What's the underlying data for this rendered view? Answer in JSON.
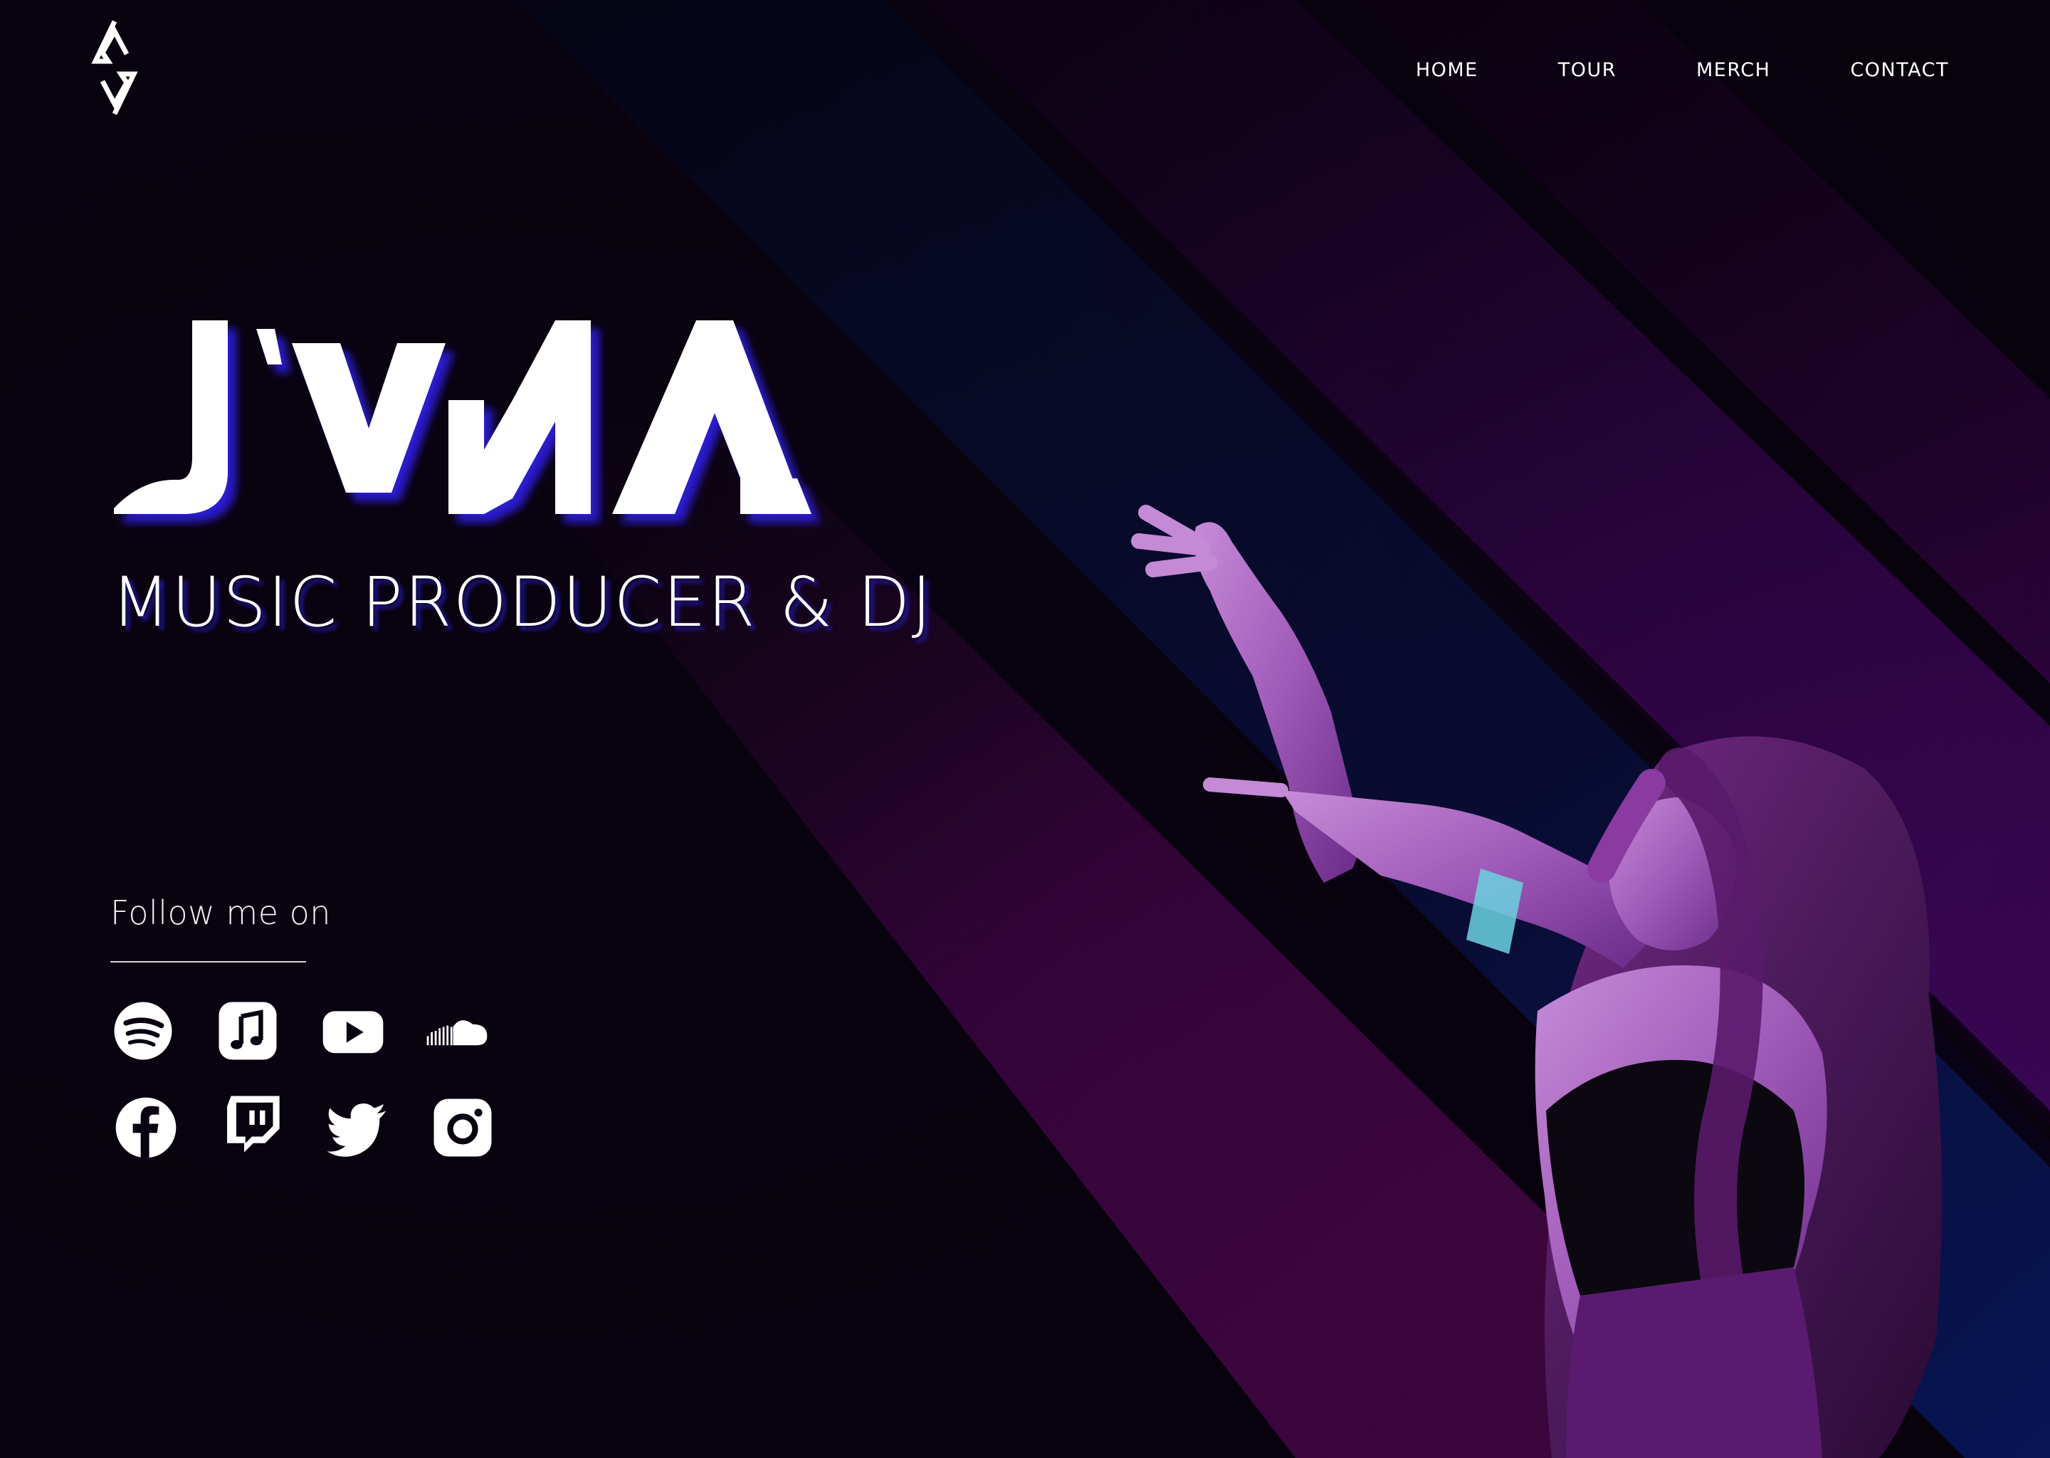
{
  "nav": {
    "items": [
      {
        "label": "HOME"
      },
      {
        "label": "TOUR"
      },
      {
        "label": "MERCH"
      },
      {
        "label": "CONTACT"
      }
    ]
  },
  "hero": {
    "brand": "JVNA",
    "subtitle": "MUSIC PRODUCER & DJ"
  },
  "follow": {
    "label": "Follow me on",
    "socials": [
      {
        "icon": "spotify-icon"
      },
      {
        "icon": "apple-music-icon"
      },
      {
        "icon": "youtube-icon"
      },
      {
        "icon": "soundcloud-icon"
      },
      {
        "icon": "facebook-icon"
      },
      {
        "icon": "twitch-icon"
      },
      {
        "icon": "twitter-icon"
      },
      {
        "icon": "instagram-icon"
      }
    ]
  },
  "colors": {
    "background": "#09030f",
    "stripe_magenta": "#6a0a86",
    "stripe_blue": "#0d1a6e",
    "text": "#ffffff",
    "shadow": "#2318a8"
  }
}
